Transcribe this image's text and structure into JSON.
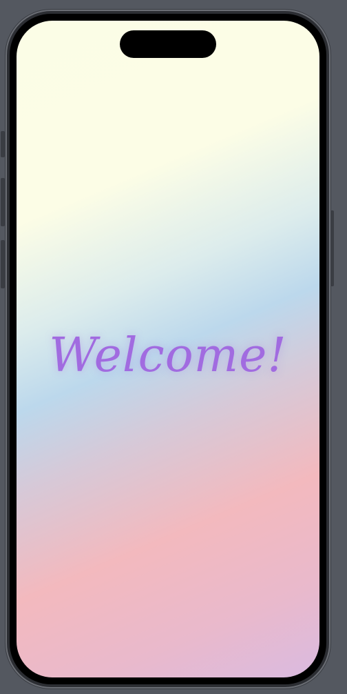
{
  "screen": {
    "welcome_text": "Welcome!",
    "text_color": "#a16be0",
    "gradient_colors": [
      "#fbfde6",
      "#bcd8ec",
      "#f3b9be",
      "#dabae0"
    ]
  }
}
